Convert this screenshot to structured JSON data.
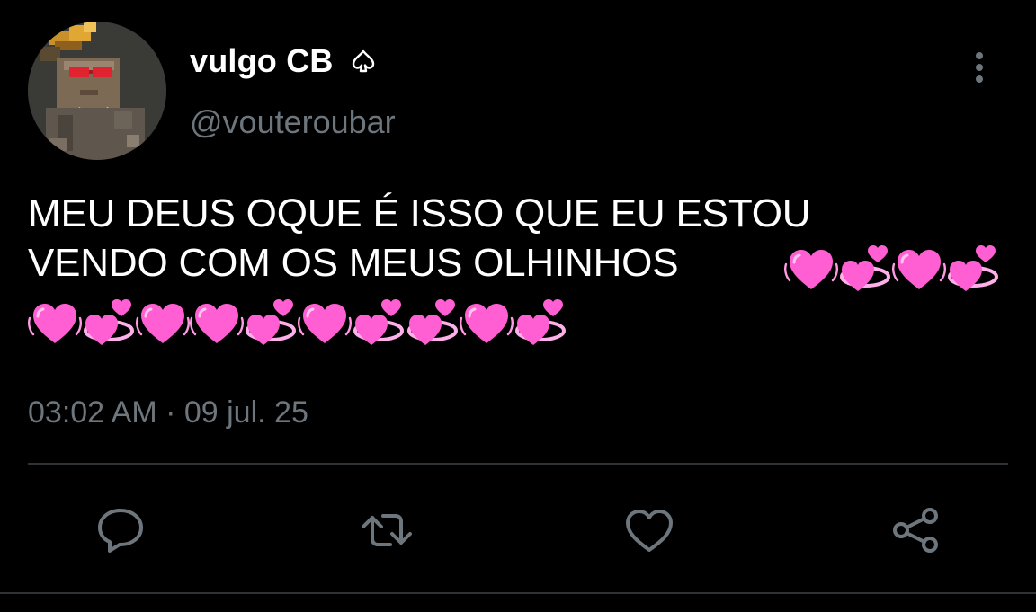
{
  "tweet": {
    "display_name": "vulgo CB",
    "name_badge_icon": "spade-outline-icon",
    "handle": "@vouteroubar",
    "text": "MEU DEUS OQUE É ISSO QUE EU ESTOU\nVENDO COM OS MEUS OLHINHOS",
    "emojis": [
      "growing-heart",
      "revolving-hearts",
      "growing-heart",
      "revolving-hearts",
      "growing-heart",
      "revolving-hearts",
      "growing-heart",
      "growing-heart",
      "revolving-hearts",
      "growing-heart",
      "revolving-hearts",
      "revolving-hearts",
      "growing-heart",
      "revolving-hearts"
    ],
    "timestamp": "03:02 AM · 09 jul. 25"
  },
  "actions": {
    "reply_icon": "reply-icon",
    "retweet_icon": "retweet-icon",
    "like_icon": "heart-icon",
    "share_icon": "share-icon"
  },
  "colors": {
    "background": "#000000",
    "primary_text": "#ffffff",
    "secondary_text": "#6e767d",
    "icon": "#6e767d",
    "divider": "#2f3336",
    "emoji_pink": "#ff5fd2"
  }
}
